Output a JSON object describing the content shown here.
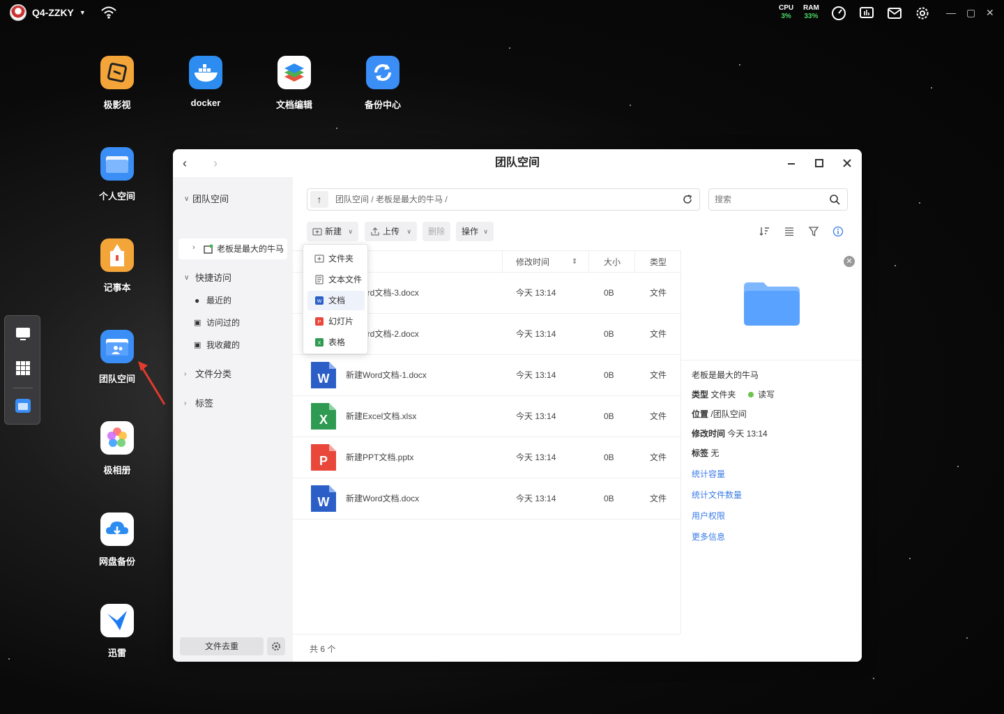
{
  "topbar": {
    "device_name": "Q4-ZZKY",
    "cpu_label": "CPU",
    "cpu_value": "3%",
    "ram_label": "RAM",
    "ram_value": "33%"
  },
  "desktop_apps": [
    {
      "label": "极影视",
      "color": "#f4a53a"
    },
    {
      "label": "docker",
      "color": "#2d8cf0"
    },
    {
      "label": "文档编辑",
      "color": "#ffffff"
    },
    {
      "label": "备份中心",
      "color": "#3a8ef6"
    },
    {
      "label": "个人空间",
      "color": "#3a8ef6"
    },
    {
      "label": "记事本",
      "color": "#f4a53a"
    },
    {
      "label": "团队空间",
      "color": "#3a8ef6"
    },
    {
      "label": "极相册",
      "color": "#ffffff"
    },
    {
      "label": "网盘备份",
      "color": "#ffffff"
    },
    {
      "label": "迅雷",
      "color": "#ffffff"
    }
  ],
  "window": {
    "title": "团队空间",
    "sidebar": {
      "root": "团队空间",
      "selected": "老板是最大的牛马",
      "quick_access": "快捷访问",
      "recent": "最近的",
      "visited": "访问过的",
      "favorites": "我收藏的",
      "file_category": "文件分类",
      "tags": "标签",
      "dedup_button": "文件去重"
    },
    "path": "团队空间 / 老板是最大的牛马 /",
    "search_placeholder": "搜索",
    "toolbar": {
      "new": "新建",
      "upload": "上传",
      "delete": "删除",
      "actions": "操作"
    },
    "new_menu": {
      "folder": "文件夹",
      "text_file": "文本文件",
      "doc": "文档",
      "slides": "幻灯片",
      "sheet": "表格"
    },
    "columns": {
      "modified": "修改时间",
      "size": "大小",
      "type": "类型"
    },
    "files": [
      {
        "name": "新建Word文档-3.docx",
        "visible_name": "ord文档-3.docx",
        "modified": "今天 13:14",
        "size": "0B",
        "type": "文件",
        "kind": "word"
      },
      {
        "name": "新建Word文档-2.docx",
        "visible_name": "ord文档-2.docx",
        "modified": "今天 13:14",
        "size": "0B",
        "type": "文件",
        "kind": "word"
      },
      {
        "name": "新建Word文档-1.docx",
        "visible_name": "新建Word文档-1.docx",
        "modified": "今天 13:14",
        "size": "0B",
        "type": "文件",
        "kind": "word"
      },
      {
        "name": "新建Excel文档.xlsx",
        "visible_name": "新建Excel文档.xlsx",
        "modified": "今天 13:14",
        "size": "0B",
        "type": "文件",
        "kind": "excel"
      },
      {
        "name": "新建PPT文档.pptx",
        "visible_name": "新建PPT文档.pptx",
        "modified": "今天 13:14",
        "size": "0B",
        "type": "文件",
        "kind": "ppt"
      },
      {
        "name": "新建Word文档.docx",
        "visible_name": "新建Word文档.docx",
        "modified": "今天 13:14",
        "size": "0B",
        "type": "文件",
        "kind": "word"
      }
    ],
    "footer": "共 6 个",
    "detail": {
      "name": "老板是最大的牛马",
      "type_label": "类型",
      "type_value": "文件夹",
      "perm": "读写",
      "location_label": "位置",
      "location_value": "/团队空间",
      "modified_label": "修改时间",
      "modified_value": "今天 13:14",
      "tag_label": "标签",
      "tag_value": "无",
      "links": [
        "统计容量",
        "统计文件数量",
        "用户权限",
        "更多信息"
      ]
    }
  }
}
